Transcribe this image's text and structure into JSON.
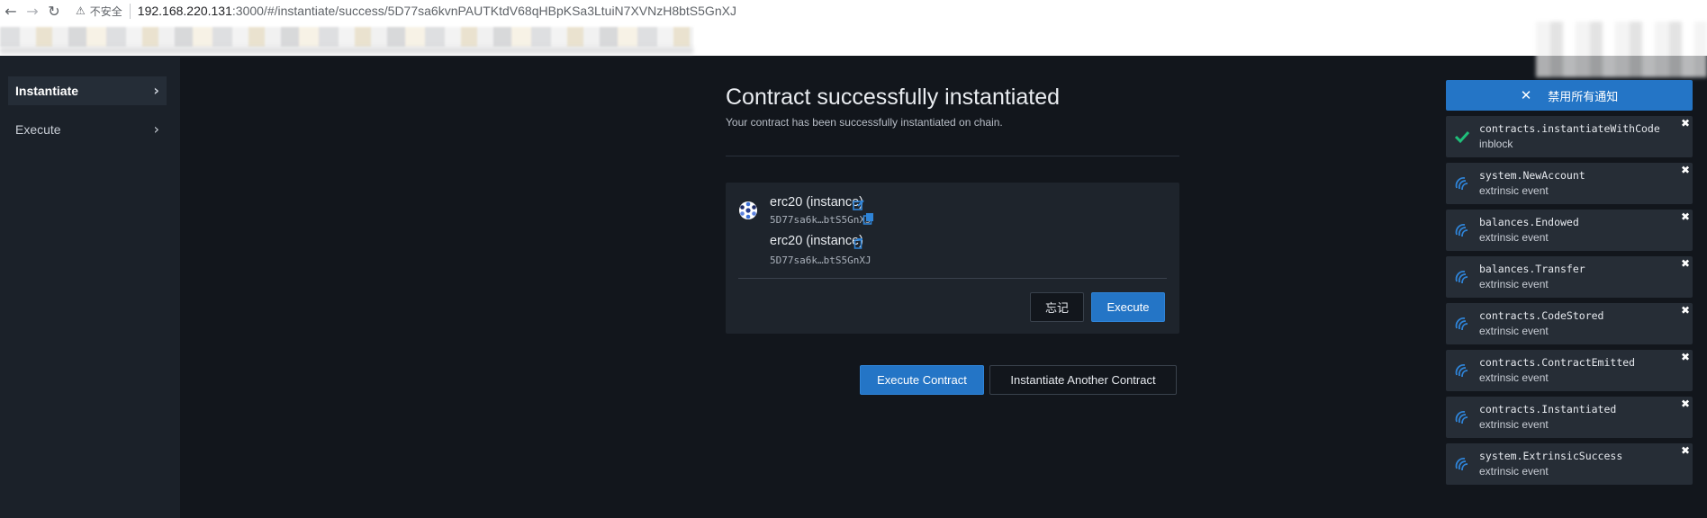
{
  "browser": {
    "insecure_label": "不安全",
    "url_host": "192.168.220.131",
    "url_path": ":3000/#/instantiate/success/5D77sa6kvnPAUTKtdV68qHBpKSa3LtuiN7XVNzH8btS5GnXJ"
  },
  "sidebar": {
    "items": [
      {
        "label": "Instantiate"
      },
      {
        "label": "Execute"
      }
    ]
  },
  "main": {
    "title": "Contract successfully instantiated",
    "subtitle": "Your contract has been successfully instantiated on chain.",
    "card": {
      "name_1": "erc20 (instance)",
      "addr_1": "5D77sa6k…btS5GnXJ",
      "name_2": "erc20 (instance)",
      "addr_2": "5D77sa6k…btS5GnXJ",
      "forget_label": "忘记",
      "execute_label": "Execute"
    },
    "actions": {
      "execute_contract": "Execute Contract",
      "instantiate_another": "Instantiate Another Contract"
    }
  },
  "notifications": {
    "dismiss_all_label": "禁用所有通知",
    "items": [
      {
        "title": "contracts.instantiateWithCode",
        "status": "inblock",
        "icon": "check-icon"
      },
      {
        "title": "system.NewAccount",
        "status": "extrinsic event",
        "icon": "event-icon"
      },
      {
        "title": "balances.Endowed",
        "status": "extrinsic event",
        "icon": "event-icon"
      },
      {
        "title": "balances.Transfer",
        "status": "extrinsic event",
        "icon": "event-icon"
      },
      {
        "title": "contracts.CodeStored",
        "status": "extrinsic event",
        "icon": "event-icon"
      },
      {
        "title": "contracts.ContractEmitted",
        "status": "extrinsic event",
        "icon": "event-icon"
      },
      {
        "title": "contracts.Instantiated",
        "status": "extrinsic event",
        "icon": "event-icon"
      },
      {
        "title": "system.ExtrinsicSuccess",
        "status": "extrinsic event",
        "icon": "event-icon"
      }
    ]
  },
  "colors": {
    "accent": "#2475c6",
    "background": "#12161c",
    "sidebar": "#1b2129",
    "success": "#1fbf7a"
  }
}
